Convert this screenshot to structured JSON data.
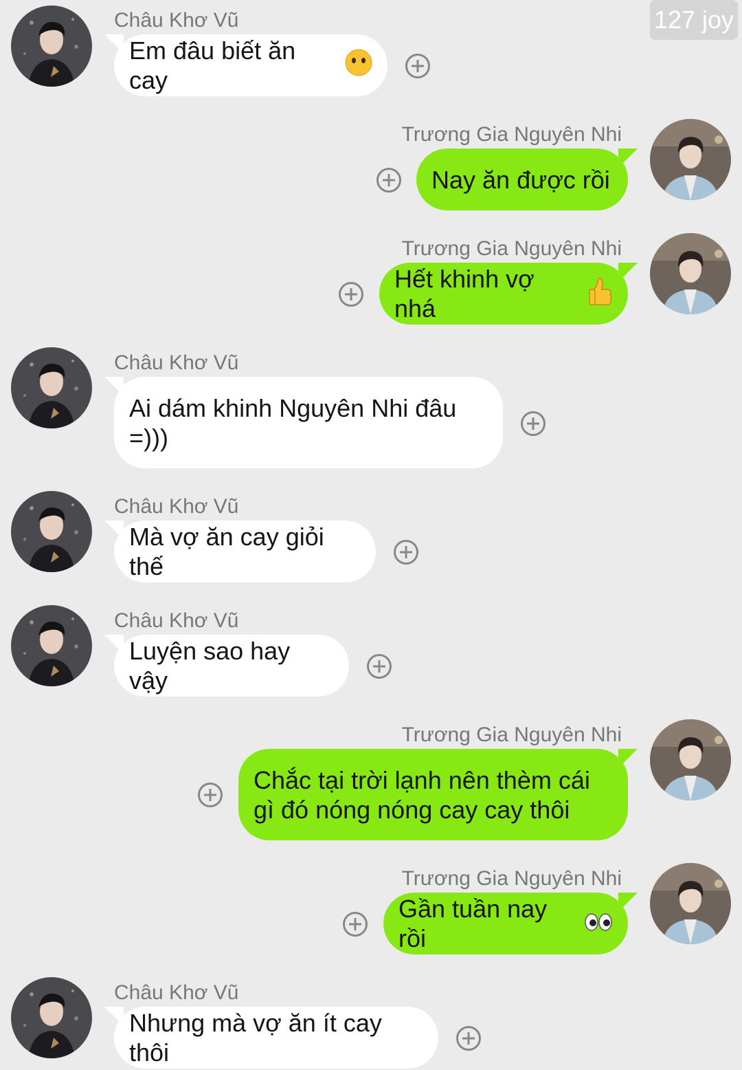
{
  "watermark": "127 joy",
  "contacts": {
    "left": "Châu Khơ Vũ",
    "right": "Trương Gia Nguyên Nhi"
  },
  "messages": [
    {
      "sender": "Châu Khơ Vũ",
      "text": "Em đâu biết ăn cay",
      "emoji": "neutral-face-emoji"
    },
    {
      "sender": "Trương Gia Nguyên Nhi",
      "text": "Nay ăn được rồi"
    },
    {
      "sender": "Trương Gia Nguyên Nhi",
      "text": "Hết khinh vợ nhá",
      "emoji": "thumbs-up-emoji"
    },
    {
      "sender": "Châu Khơ Vũ",
      "text": "Ai dám khinh Nguyên Nhi đâu\n=)))"
    },
    {
      "sender": "Châu Khơ Vũ",
      "text": "Mà vợ ăn cay giỏi thế"
    },
    {
      "sender": "Châu Khơ Vũ",
      "text": "Luyện sao hay vậy"
    },
    {
      "sender": "Trương Gia Nguyên Nhi",
      "text": "Chắc tại trời lạnh nên thèm cái\ngì đó nóng nóng cay cay thôi"
    },
    {
      "sender": "Trương Gia Nguyên Nhi",
      "text": "Gần tuần nay rồi",
      "emoji": "eyes-emoji"
    },
    {
      "sender": "Châu Khơ Vũ",
      "text": "Nhưng mà vợ ăn ít cay thôi"
    }
  ],
  "colors": {
    "background": "#ebebeb",
    "incoming_bubble": "#ffffff",
    "outgoing_bubble": "#88e814",
    "sender_name": "#777777",
    "add_icon": "#878787"
  }
}
